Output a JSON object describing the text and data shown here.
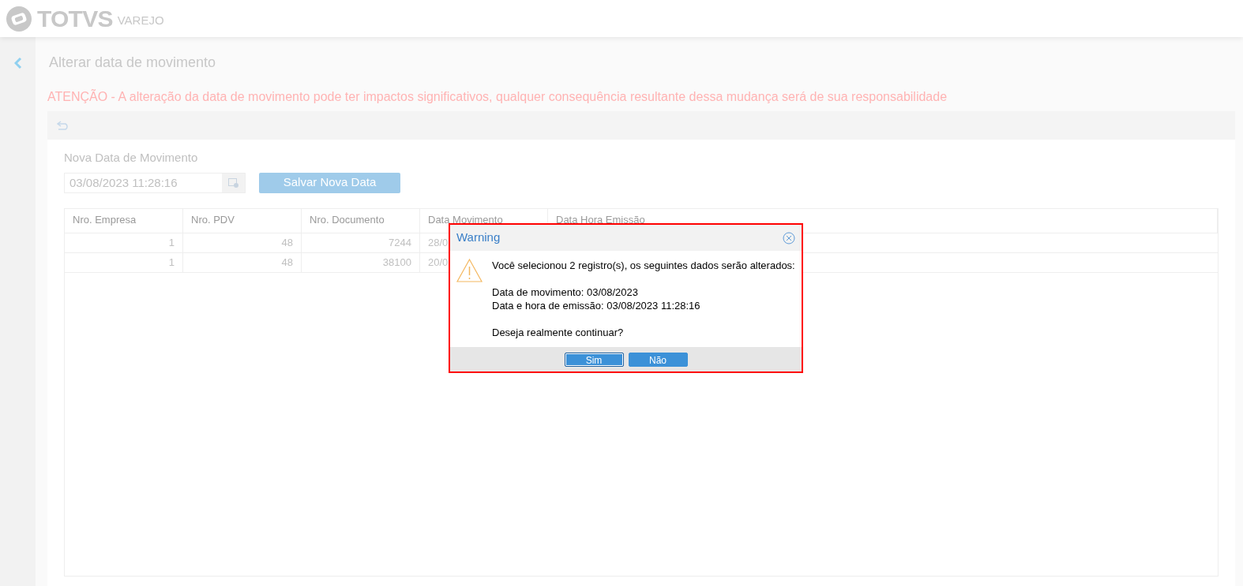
{
  "header": {
    "logo": "TOTVS",
    "product": "VAREJO"
  },
  "page": {
    "title": "Alterar data de movimento",
    "warning": "ATENÇÃO - A alteração da data de movimento pode ter impactos significativos, qualquer consequência resultante dessa mudança será de sua responsabilidade"
  },
  "form": {
    "label": "Nova Data de Movimento",
    "date_value": "03/08/2023 11:28:16",
    "save_button": "Salvar Nova Data"
  },
  "table": {
    "columns": [
      "Nro. Empresa",
      "Nro. PDV",
      "Nro. Documento",
      "Data Movimento",
      "Data Hora Emissão"
    ],
    "rows": [
      [
        "1",
        "48",
        "7244",
        "28/0"
      ],
      [
        "1",
        "48",
        "38100",
        "20/0"
      ]
    ]
  },
  "dialog": {
    "title": "Warning",
    "lines": [
      "Você selecionou 2 registro(s), os seguintes dados serão alterados:",
      "Data de movimento: 03/08/2023",
      "Data e hora de emissão: 03/08/2023 11:28:16",
      "Deseja realmente continuar?"
    ],
    "buttons": [
      {
        "label": "Sim",
        "selected": true
      },
      {
        "label": "Não",
        "selected": false
      }
    ]
  }
}
